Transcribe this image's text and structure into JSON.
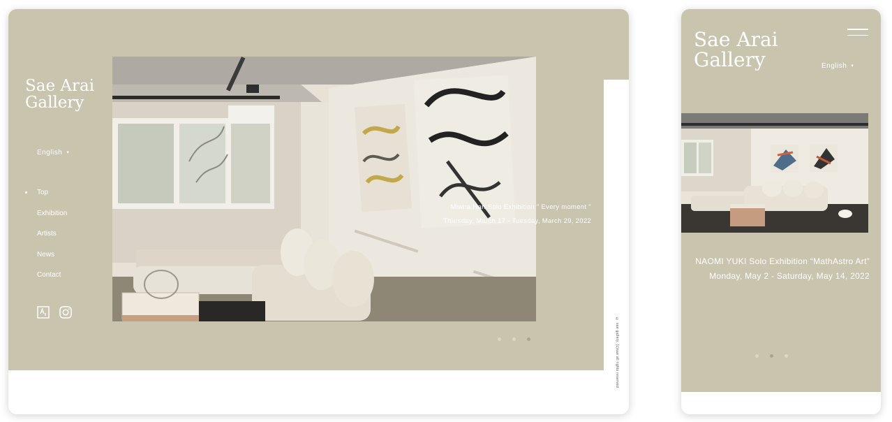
{
  "brand": {
    "line1": "Sae Arai",
    "line2": "Gallery"
  },
  "language": {
    "label": "English",
    "caret": "▾"
  },
  "nav": [
    {
      "label": "Top",
      "active": true
    },
    {
      "label": "Exhibition",
      "active": false
    },
    {
      "label": "Artists",
      "active": false
    },
    {
      "label": "News",
      "active": false
    },
    {
      "label": "Contact",
      "active": false
    }
  ],
  "social": [
    "artsy-icon",
    "instagram-icon"
  ],
  "desktop_slide": {
    "title": "Miwha Han Solo Exhibition \" Every moment \"",
    "dates": "Thursday, March 17 - Tuesday, March 29, 2022",
    "slide_count": 3,
    "active_slide": 3
  },
  "mobile_slide": {
    "title": "NAOMI YUKI Solo Exhibition “MathAstro Art”",
    "dates": "Monday, May 2 - Saturday, May 14, 2022",
    "slide_count": 3,
    "active_slide": 2
  },
  "copyright": "© sae gallery, (c)sae all rights reserved",
  "colors": {
    "beige": "#c9c4ae",
    "white": "#ffffff",
    "dot": "#dcd8c6",
    "dot_active": "#a9a48f"
  }
}
